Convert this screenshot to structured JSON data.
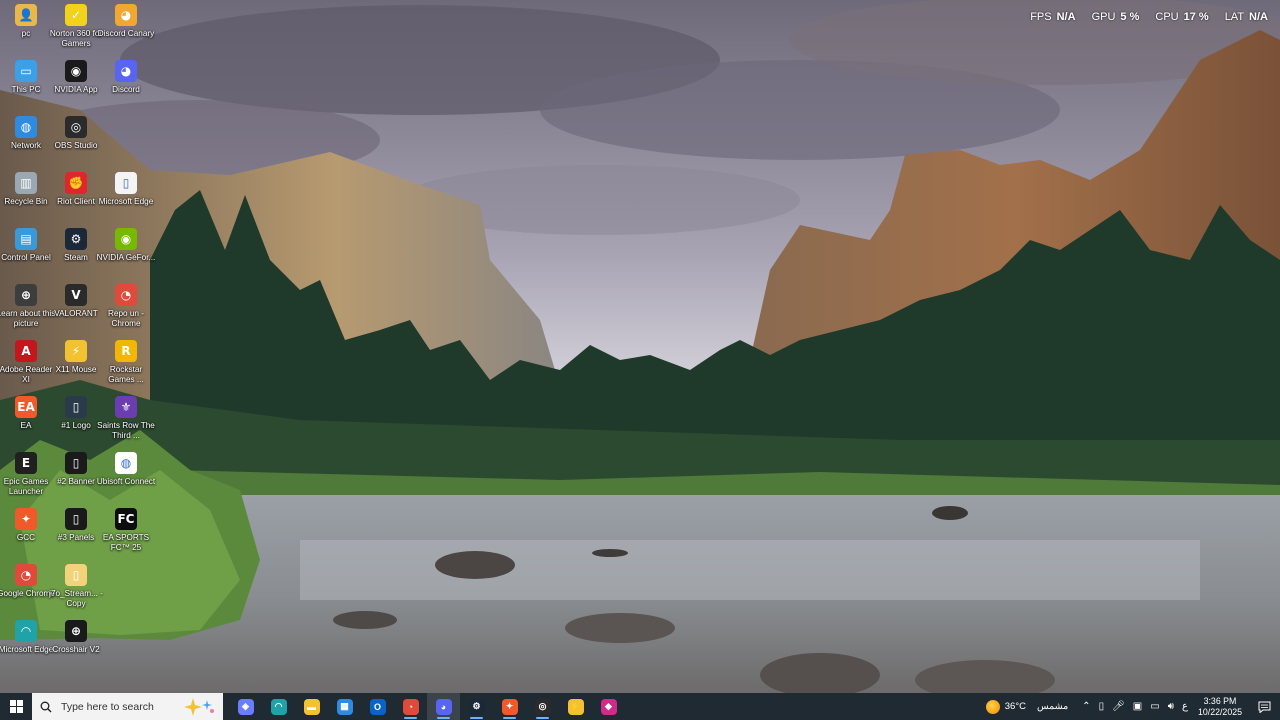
{
  "perf": [
    {
      "label": "FPS",
      "value": "N/A"
    },
    {
      "label": "GPU",
      "value": "5 %"
    },
    {
      "label": "CPU",
      "value": "17 %"
    },
    {
      "label": "LAT",
      "value": "N/A"
    }
  ],
  "desktop_icons": [
    {
      "label": "pc",
      "icon": "user-folder-icon",
      "color": "#e8b84a",
      "glyph": "👤"
    },
    {
      "label": "Norton 360 for Gamers",
      "icon": "norton-icon",
      "color": "#f2d21a",
      "glyph": "✓"
    },
    {
      "label": "Discord Canary",
      "icon": "discord-canary-icon",
      "color": "#f0a830",
      "glyph": "◕"
    },
    {
      "label": "This PC",
      "icon": "this-pc-icon",
      "color": "#3aa0e8",
      "glyph": "▭"
    },
    {
      "label": "NVIDIA App",
      "icon": "nvidia-app-icon",
      "color": "#1a1a1a",
      "glyph": "◉"
    },
    {
      "label": "Discord",
      "icon": "discord-icon",
      "color": "#5865f2",
      "glyph": "◕"
    },
    {
      "label": "Network",
      "icon": "network-icon",
      "color": "#2f8be0",
      "glyph": "◍"
    },
    {
      "label": "OBS Studio",
      "icon": "obs-icon",
      "color": "#2b2b2b",
      "glyph": "◎"
    },
    {
      "label": "Recycle Bin",
      "icon": "recycle-bin-icon",
      "color": "#9aa8b3",
      "glyph": "▥"
    },
    {
      "label": "Riot Client",
      "icon": "riot-client-icon",
      "color": "#e0252c",
      "glyph": "✊"
    },
    {
      "label": "Microsoft Edge",
      "icon": "edge-file-icon",
      "color": "#f4f4f4",
      "glyph": "▯"
    },
    {
      "label": "Control Panel",
      "icon": "control-panel-icon",
      "color": "#3a9ad9",
      "glyph": "▤"
    },
    {
      "label": "Steam",
      "icon": "steam-icon",
      "color": "#1b2838",
      "glyph": "⚙"
    },
    {
      "label": "NVIDIA GeFor...",
      "icon": "geforce-icon",
      "color": "#76b900",
      "glyph": "◉"
    },
    {
      "label": "Learn about this picture",
      "icon": "learn-picture-icon",
      "color": "#3d3d3d",
      "glyph": "⊕"
    },
    {
      "label": "VALORANT",
      "icon": "valorant-icon",
      "color": "#2a2a2a",
      "glyph": "V"
    },
    {
      "label": "Repo un - Chrome",
      "icon": "chrome-repo-icon",
      "color": "#e04a3a",
      "glyph": "◔"
    },
    {
      "label": "Adobe Reader XI",
      "icon": "adobe-reader-icon",
      "color": "#c4161c",
      "glyph": "A"
    },
    {
      "label": "X11 Mouse",
      "icon": "x11-mouse-icon",
      "color": "#f2c230",
      "glyph": "⚡"
    },
    {
      "label": "Rockstar Games ...",
      "icon": "rockstar-icon",
      "color": "#f2b705",
      "glyph": "R"
    },
    {
      "label": "EA",
      "icon": "ea-icon",
      "color": "#f05a28",
      "glyph": "EA"
    },
    {
      "label": "#1 Logo",
      "icon": "logo-file-icon",
      "color": "#2a3a4a",
      "glyph": "▯"
    },
    {
      "label": "Saints Row The Third ...",
      "icon": "saints-row-icon",
      "color": "#6a3db0",
      "glyph": "⚜"
    },
    {
      "label": "Epic Games Launcher",
      "icon": "epic-games-icon",
      "color": "#202020",
      "glyph": "E"
    },
    {
      "label": "#2 Banner",
      "icon": "banner-file-icon",
      "color": "#1a1a1a",
      "glyph": "▯"
    },
    {
      "label": "Ubisoft Connect",
      "icon": "ubisoft-icon",
      "color": "#ffffff",
      "glyph": "◍"
    },
    {
      "label": "GCC",
      "icon": "gcc-icon",
      "color": "#f05a28",
      "glyph": "✦"
    },
    {
      "label": "#3 Panels",
      "icon": "panels-file-icon",
      "color": "#1a1a1a",
      "glyph": "▯"
    },
    {
      "label": "EA SPORTS FC™ 25",
      "icon": "ea-sports-fc-icon",
      "color": "#0d0d0d",
      "glyph": "FC"
    },
    {
      "label": "Google Chrome",
      "icon": "google-chrome-icon",
      "color": "#e04a3a",
      "glyph": "◔"
    },
    {
      "label": "j7o_Stream... - Copy",
      "icon": "stream-folder-icon",
      "color": "#f2d27a",
      "glyph": "▯"
    },
    {
      "label": "Microsoft Edge",
      "icon": "microsoft-edge-icon",
      "color": "#1fa3a8",
      "glyph": "◠"
    },
    {
      "label": "Crosshair V2",
      "icon": "crosshair-icon",
      "color": "#1a1a1a",
      "glyph": "⊕"
    }
  ],
  "taskbar": {
    "search_placeholder": "Type here to search",
    "apps": [
      {
        "name": "copilot-taskbar-icon",
        "color": "#6b7dff",
        "glyph": "◈",
        "active": false
      },
      {
        "name": "edge-taskbar-icon",
        "color": "#1fa3a8",
        "glyph": "◠",
        "active": false
      },
      {
        "name": "file-explorer-taskbar-icon",
        "color": "#f2c230",
        "glyph": "▬",
        "active": false
      },
      {
        "name": "microsoft-store-taskbar-icon",
        "color": "#2f8be0",
        "glyph": "▦",
        "active": false
      },
      {
        "name": "outlook-taskbar-icon",
        "color": "#0a64c8",
        "glyph": "O",
        "active": false
      },
      {
        "name": "chrome-taskbar-icon",
        "color": "#e04a3a",
        "glyph": "◔",
        "active": true
      },
      {
        "name": "discord-taskbar-icon",
        "color": "#5865f2",
        "glyph": "◕",
        "active": true,
        "highlight": true
      },
      {
        "name": "steam-taskbar-icon",
        "color": "#1b2838",
        "glyph": "⚙",
        "active": true
      },
      {
        "name": "gcc-taskbar-icon",
        "color": "#f05a28",
        "glyph": "✦",
        "active": true
      },
      {
        "name": "obs-taskbar-icon",
        "color": "#2b2b2b",
        "glyph": "◎",
        "active": true
      },
      {
        "name": "x11-mouse-taskbar-icon",
        "color": "#f2c230",
        "glyph": "⚡",
        "active": false
      },
      {
        "name": "app-taskbar-icon",
        "color": "#d02a8a",
        "glyph": "◆",
        "active": false
      }
    ],
    "weather_temp": "36°C",
    "weather_desc": "مشمس",
    "lang": "ع",
    "time": "3:36 PM",
    "date": "10/22/2025"
  }
}
